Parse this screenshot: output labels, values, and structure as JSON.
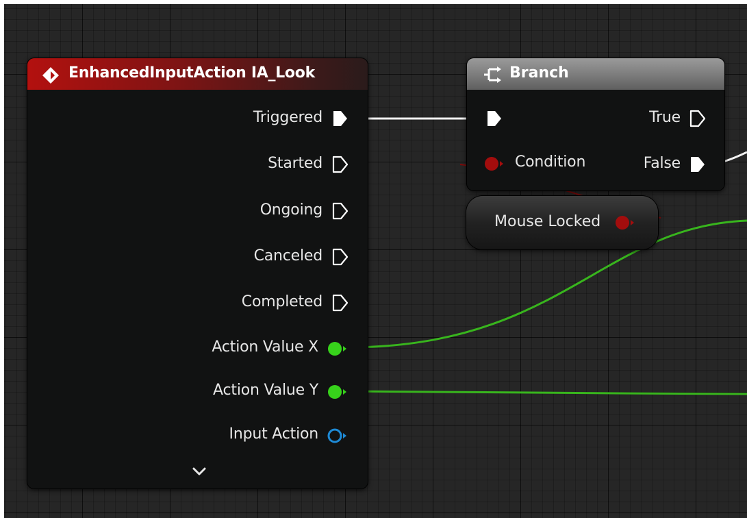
{
  "canvas": {
    "background": "#262626"
  },
  "input_action_node": {
    "title": "EnhancedInputAction IA_Look",
    "header_color": "#b3110f",
    "exec_outputs": [
      {
        "label": "Triggered",
        "connected": true
      },
      {
        "label": "Started",
        "connected": false
      },
      {
        "label": "Ongoing",
        "connected": false
      },
      {
        "label": "Canceled",
        "connected": false
      },
      {
        "label": "Completed",
        "connected": false
      }
    ],
    "value_outputs": [
      {
        "label": "Action Value X",
        "pin_color": "#37d21b",
        "connected": true
      },
      {
        "label": "Action Value Y",
        "pin_color": "#37d21b",
        "connected": true
      },
      {
        "label": "Input Action",
        "pin_color": "#1e8ad6",
        "connected": false
      }
    ],
    "expand_icon": "chevron-down-icon"
  },
  "branch_node": {
    "title": "Branch",
    "icon": "branch-icon",
    "header_color": "#7b7b7b",
    "inputs": {
      "condition_label": "Condition",
      "condition_pin_color": "#a30d0d"
    },
    "outputs": {
      "true_label": "True",
      "false_label": "False"
    }
  },
  "variable_node": {
    "label": "Mouse Locked",
    "pin_color": "#a30d0d"
  },
  "wire_colors": {
    "exec": "#ffffff",
    "float": "#37d21b",
    "bool": "#8a0b0b"
  }
}
